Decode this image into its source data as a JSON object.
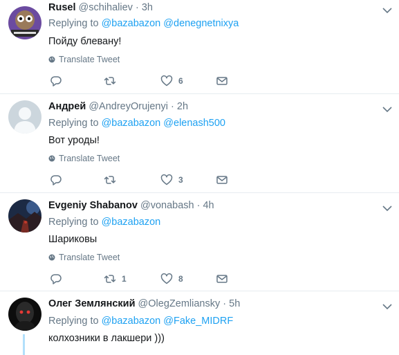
{
  "tweets": [
    {
      "name": "Rusel",
      "handle": "@schihaliev",
      "dot": "·",
      "time": "3h",
      "replying_prefix": "Replying to",
      "mentions": [
        "@bazabazon",
        "@denegnetnixya"
      ],
      "text": "Пойду блевану!",
      "translate": "Translate Tweet",
      "retweets": "",
      "likes": "6"
    },
    {
      "name": "Андрей",
      "handle": "@AndreyOrujenyi",
      "dot": "·",
      "time": "2h",
      "replying_prefix": "Replying to",
      "mentions": [
        "@bazabazon",
        "@elenash500"
      ],
      "text": "Вот уроды!",
      "translate": "Translate Tweet",
      "retweets": "",
      "likes": "3"
    },
    {
      "name": "Evgeniy Shabanov",
      "handle": "@vonabash",
      "dot": "·",
      "time": "4h",
      "replying_prefix": "Replying to",
      "mentions": [
        "@bazabazon"
      ],
      "text": "Шариковы",
      "translate": "Translate Tweet",
      "retweets": "1",
      "likes": "8"
    },
    {
      "name": "Олег Землянский",
      "handle": "@OlegZemliansky",
      "dot": "·",
      "time": "5h",
      "replying_prefix": "Replying to",
      "mentions": [
        "@bazabazon",
        "@Fake_MIDRF"
      ],
      "text": "колхозники в лакшери )))"
    }
  ],
  "colors": {
    "link": "#1da1f2",
    "muted": "#657786",
    "divider": "#e6ecf0",
    "thread_line": "#b2dffb"
  },
  "icons": [
    "chevron-down-icon",
    "globe-icon",
    "reply-icon",
    "retweet-icon",
    "heart-icon",
    "message-icon"
  ]
}
